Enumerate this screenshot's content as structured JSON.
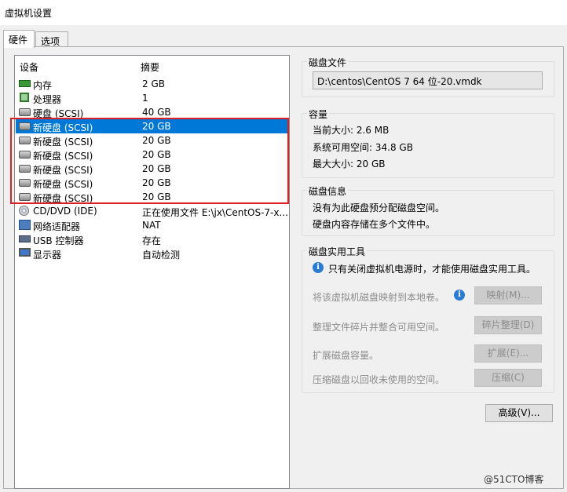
{
  "window": {
    "title": "虚拟机设置"
  },
  "tabs": [
    {
      "label": "硬件"
    },
    {
      "label": "选项"
    }
  ],
  "device_list": {
    "headers": {
      "device": "设备",
      "summary": "摘要"
    },
    "rows": [
      {
        "name": "内存",
        "summary": "2 GB",
        "icon": "memory-icon"
      },
      {
        "name": "处理器",
        "summary": "1",
        "icon": "cpu-icon"
      },
      {
        "name": "硬盘 (SCSI)",
        "summary": "40 GB",
        "icon": "hard-disk-icon"
      },
      {
        "name": "新硬盘 (SCSI)",
        "summary": "20 GB",
        "icon": "hard-disk-icon",
        "selected": true
      },
      {
        "name": "新硬盘 (SCSI)",
        "summary": "20 GB",
        "icon": "hard-disk-icon"
      },
      {
        "name": "新硬盘 (SCSI)",
        "summary": "20 GB",
        "icon": "hard-disk-icon"
      },
      {
        "name": "新硬盘 (SCSI)",
        "summary": "20 GB",
        "icon": "hard-disk-icon"
      },
      {
        "name": "新硬盘 (SCSI)",
        "summary": "20 GB",
        "icon": "hard-disk-icon"
      },
      {
        "name": "新硬盘 (SCSI)",
        "summary": "20 GB",
        "icon": "hard-disk-icon"
      },
      {
        "name": "CD/DVD (IDE)",
        "summary": "正在使用文件 E:\\jx\\CentOS-7-x...",
        "icon": "cd-dvd-icon"
      },
      {
        "name": "网络适配器",
        "summary": "NAT",
        "icon": "network-adapter-icon"
      },
      {
        "name": "USB 控制器",
        "summary": "存在",
        "icon": "usb-icon"
      },
      {
        "name": "显示器",
        "summary": "自动检测",
        "icon": "monitor-icon"
      }
    ]
  },
  "disk_file": {
    "title": "磁盘文件",
    "path": "D:\\centos\\CentOS 7 64 位-20.vmdk"
  },
  "capacity": {
    "title": "容量",
    "current": "当前大小: 2.6 MB",
    "free": "系统可用空间: 34.8 GB",
    "max": "最大大小: 20 GB"
  },
  "disk_info": {
    "title": "磁盘信息",
    "line1": "没有为此硬盘预分配磁盘空间。",
    "line2": "硬盘内容存储在多个文件中。"
  },
  "utilities": {
    "title": "磁盘实用工具",
    "note": "只有关闭虚拟机电源时，才能使用磁盘实用工具。",
    "map_label": "将该虚拟机磁盘映射到本地卷。",
    "map_button": "映射(M)...",
    "defrag_label": "整理文件碎片并整合可用空间。",
    "defrag_button": "碎片整理(D)",
    "expand_label": "扩展磁盘容量。",
    "expand_button": "扩展(E)...",
    "compact_label": "压缩磁盘以回收未使用的空间。",
    "compact_button": "压缩(C)"
  },
  "advanced_button": "高级(V)...",
  "watermark": "@51CTO博客"
}
